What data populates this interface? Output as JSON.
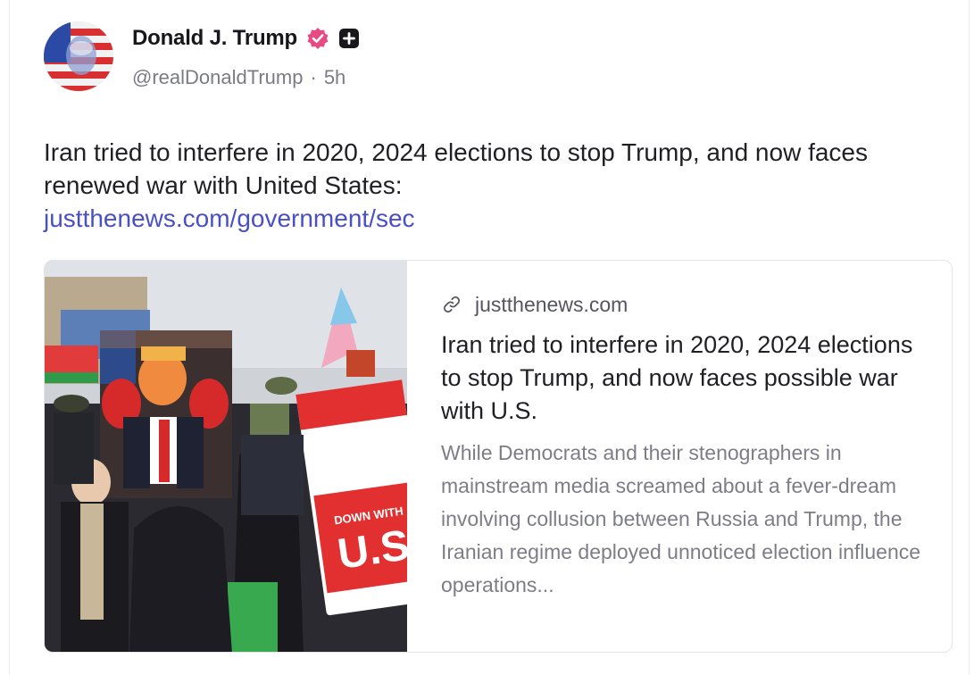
{
  "post": {
    "author": {
      "display_name": "Donald J. Trump",
      "handle": "@realDonaldTrump",
      "separator": "·",
      "time": "5h",
      "verified_icon": "verified-badge-icon",
      "extra_icon": "plus-square-icon"
    },
    "text": "Iran tried to interfere in 2020, 2024 elections to stop Trump, and now faces renewed war with United States:",
    "link": "justthenews.com/government/sec"
  },
  "card": {
    "link_icon": "link-icon",
    "domain": "justthenews.com",
    "title": "Iran tried to interfere in 2020, 2024 elections to stop Trump, and now faces possible war with U.S.",
    "description": "While Democrats and their stenographers in mainstream media screamed about a fever-dream involving collusion between Russia and Trump, the Iranian regime deployed unnoticed election influence operations...",
    "image_sign_text": "DOWN WITH U.S"
  },
  "colors": {
    "verified": "#e84a86",
    "link": "#4a4fc4",
    "muted": "#7b7b85"
  }
}
